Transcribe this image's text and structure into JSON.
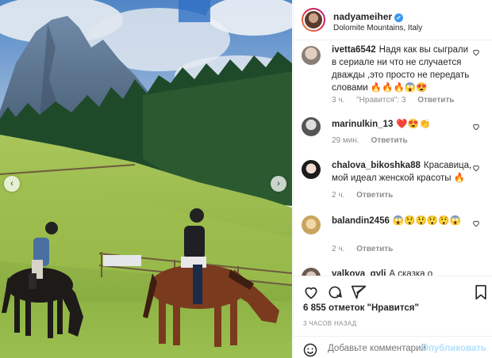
{
  "post": {
    "username": "nadyameiher",
    "location": "Dolomite Mountains, Italy",
    "likes": "6 855 отметок \"Нравится\"",
    "time": "3 ЧАСОВ НАЗАД"
  },
  "comments": [
    {
      "user": "ivetta6542",
      "text": "Надя как вы сыграли в сериале ни что не случается дважды ,это просто не передать словами 🔥🔥🔥😱😍",
      "time": "3 ч.",
      "likes": "\"Нравится\": 3",
      "reply": "Ответить"
    },
    {
      "user": "marinulkin_13",
      "text": "❤️😍👏",
      "time": "29 мин.",
      "reply": "Ответить"
    },
    {
      "user": "chalova_bikoshka88",
      "text": "Красавица, мой идеал женской красоты 🔥",
      "time": "2 ч.",
      "reply": "Ответить"
    },
    {
      "user": "balandin2456",
      "text": "😱😲😲😲😲😱",
      "time": "2 ч.",
      "reply": "Ответить"
    }
  ],
  "partial_comment": {
    "user": "valkova_gyli",
    "text": "А сказка о"
  },
  "add_comment": {
    "placeholder": "Добавьте комментарий...",
    "publish_label": "Опубликовать"
  },
  "icons": {
    "verified": "verified-badge-icon",
    "more": "more-options-icon",
    "like": "heart-icon",
    "comment": "comment-icon",
    "share": "share-icon",
    "save": "bookmark-icon",
    "emoji": "emoji-icon",
    "prev": "chevron-left-icon",
    "next": "chevron-right-icon"
  },
  "colors": {
    "accent_blue": "#3897f0",
    "publish_disabled": "#b2dffc",
    "meta_gray": "#8e8e8e"
  }
}
